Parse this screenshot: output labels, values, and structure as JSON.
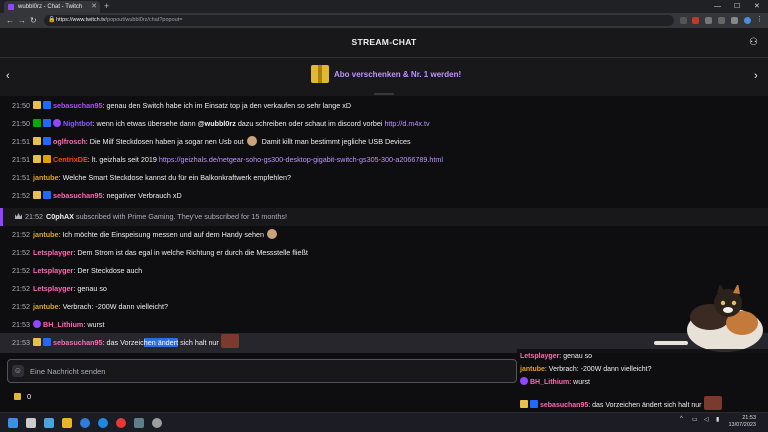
{
  "browser": {
    "tab_title": "wubbl0rz - Chat - Twitch",
    "url_host": "https://www.twitch.tv",
    "url_path": "/popout/wubbl0rz/chat?popout="
  },
  "header": {
    "title": "STREAM-CHAT"
  },
  "gift_banner": {
    "text": "Abo verschenken & Nr. 1 werden!"
  },
  "messages": [
    {
      "time": "21:50",
      "badges": [
        "sub",
        "prime"
      ],
      "user": "sebasuchan95",
      "color": "#b34dff",
      "text": "genau den Switch habe ich im Einsatz top ja den verkaufen so sehr lange xD"
    },
    {
      "time": "21:50",
      "badges": [
        "mod",
        "prime",
        "verified"
      ],
      "user": "Nightbot",
      "color": "#8a5cf6",
      "text": "wenn ich etwas übersehe dann",
      "mention": "@wubbl0rz",
      "text2": "dazu schreiben oder schaut im discord vorbei",
      "link": "http://d.m4x.tv"
    },
    {
      "time": "21:51",
      "badges": [
        "sub",
        "prime"
      ],
      "user": "oglfrosch",
      "color": "#ff69b4",
      "text": "Die Milf Steckdosen haben ja sogar nen Usb out",
      "emote": true,
      "text2": "Damit killt man bestimmt jegliche USB Devices"
    },
    {
      "time": "21:51",
      "badges": [
        "sub",
        "gift"
      ],
      "user": "CentrixDE",
      "color": "#ff4500",
      "text": "lt. geizhals seit 2019",
      "link": "https://geizhals.de/netgear-soho-gs300-desktop-gigabit-switch-gs305-300-a2066789.html"
    },
    {
      "time": "21:51",
      "badges": [],
      "user": "jantube",
      "color": "#daa520",
      "text": "Welche Smart Steckdose kannst du für ein Balkonkraftwerk empfehlen?"
    },
    {
      "time": "21:52",
      "badges": [
        "sub",
        "prime"
      ],
      "user": "sebasuchan95",
      "color": "#ff69b4",
      "text": "negativer Verbrauch xD"
    },
    {
      "time": "21:52",
      "badges": [],
      "user": "jantube",
      "color": "#daa520",
      "text": "Ich möchte die Einspeisung messen und auf dem Handy sehen",
      "emote": true
    },
    {
      "time": "21:52",
      "badges": [],
      "user": "Letsplayger",
      "color": "#ff69b4",
      "text": "Dem Strom ist das egal in welche Richtung er durch die Messstelle fließt"
    },
    {
      "time": "21:52",
      "badges": [],
      "user": "Letsplayger",
      "color": "#ff69b4",
      "text": "Der Steckdose auch"
    },
    {
      "time": "21:52",
      "badges": [],
      "user": "Letsplayger",
      "color": "#ff69b4",
      "text": "genau so"
    },
    {
      "time": "21:52",
      "badges": [],
      "user": "jantube",
      "color": "#daa520",
      "text": "Verbrach: -200W dann vielleicht?"
    },
    {
      "time": "21:53",
      "badges": [
        "verified"
      ],
      "user": "BH_Lithium",
      "color": "#ff69b4",
      "text": "wurst"
    }
  ],
  "sub_notice": {
    "time": "21:52",
    "user": "C0phAX",
    "text": "subscribed with Prime Gaming. They've subscribed for 15 months!"
  },
  "highlighted_message": {
    "time": "21:53",
    "user": "sebasuchan95",
    "text_before": "das Vorzeic",
    "text_selected": "hen ändert",
    "text_after": " sich halt nur"
  },
  "input": {
    "placeholder": "Eine Nachricht senden"
  },
  "points": {
    "value": "0"
  },
  "overlay": [
    {
      "user": "Letsplayger",
      "color": "#ff69b4",
      "text": "genau so"
    },
    {
      "user": "jantube",
      "color": "#daa520",
      "text": "Verbrach: -200W dann vielleicht?"
    },
    {
      "user": "BH_Lithium",
      "color": "#ff69b4",
      "text": "wurst"
    },
    {
      "user": "sebasuchan95",
      "color": "#ff69b4",
      "text": "das Vorzeichen ändert sich halt nur"
    }
  ],
  "taskbar": {
    "time": "21:53",
    "date": "13/07/2023"
  }
}
